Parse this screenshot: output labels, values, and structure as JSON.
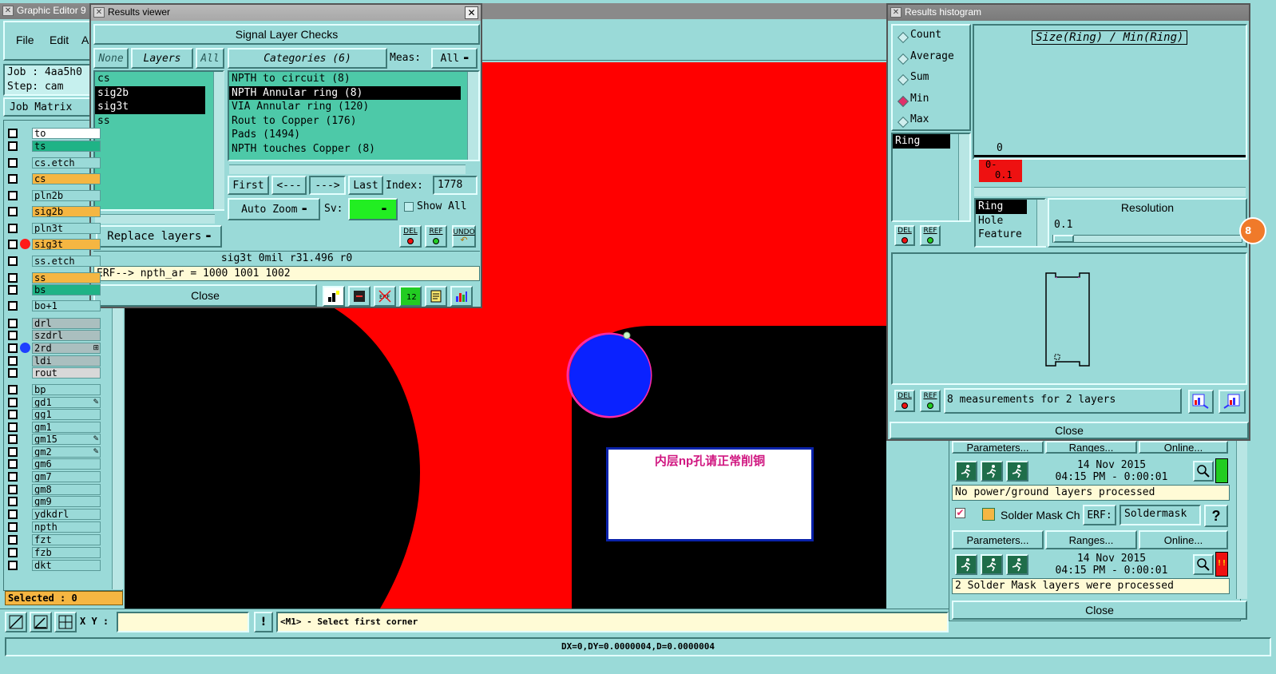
{
  "main_window": {
    "title": "Graphic Editor 9",
    "menu": [
      "File",
      "Edit",
      "A"
    ],
    "job_label": "Job : 4aa5h0",
    "step_label": "Step: cam",
    "job_matrix_label": "Job Matrix",
    "selected_label": "Selected : 0",
    "xy_label": "X Y :",
    "xy_value": "",
    "prompt": "<M1> - Select first corner",
    "status_bar": "DX=0,DY=0.0000004,D=0.0000004",
    "annotation_text": "内层np孔请正常削铜"
  },
  "layers": [
    {
      "name": "to",
      "fill": "#ffffff"
    },
    {
      "name": "ts",
      "fill": "#1fb386"
    },
    {
      "name": "cs.etch",
      "fill": "#9adad8"
    },
    {
      "name": "cs",
      "fill": "#f5b642"
    },
    {
      "name": "pln2b",
      "fill": "#9adad8"
    },
    {
      "name": "sig2b",
      "fill": "#f5b642"
    },
    {
      "name": "pln3t",
      "fill": "#9adad8"
    },
    {
      "name": "sig3t",
      "fill": "#f5b642",
      "dot": "#ff1a1a"
    },
    {
      "name": "ss.etch",
      "fill": "#9adad8"
    },
    {
      "name": "ss",
      "fill": "#f5b642"
    },
    {
      "name": "bs",
      "fill": "#1fb386"
    },
    {
      "name": "bo+1",
      "fill": "#9adad8"
    },
    {
      "name": "drl",
      "fill": "#aabfbf"
    },
    {
      "name": "szdrl",
      "fill": "#aabfbf"
    },
    {
      "name": "2rd",
      "fill": "#aabfbf",
      "dot": "#1f3fff",
      "mark": "⊞"
    },
    {
      "name": "ldi",
      "fill": "#aabfbf"
    },
    {
      "name": "rout",
      "fill": "#d8d8d8"
    },
    {
      "name": "bp",
      "fill": "#9adad8"
    },
    {
      "name": "gd1",
      "fill": "#9adad8",
      "mark": "✎"
    },
    {
      "name": "gg1",
      "fill": "#9adad8"
    },
    {
      "name": "gm1",
      "fill": "#9adad8"
    },
    {
      "name": "gm15",
      "fill": "#9adad8",
      "mark": "✎"
    },
    {
      "name": "gm2",
      "fill": "#9adad8",
      "mark": "✎"
    },
    {
      "name": "gm6",
      "fill": "#9adad8"
    },
    {
      "name": "gm7",
      "fill": "#9adad8"
    },
    {
      "name": "gm8",
      "fill": "#9adad8"
    },
    {
      "name": "gm9",
      "fill": "#9adad8"
    },
    {
      "name": "ydkdrl",
      "fill": "#9adad8"
    },
    {
      "name": "npth",
      "fill": "#9adad8"
    },
    {
      "name": "fzt",
      "fill": "#9adad8"
    },
    {
      "name": "fzb",
      "fill": "#9adad8"
    },
    {
      "name": "dkt",
      "fill": "#9adad8"
    }
  ],
  "results_viewer": {
    "title": "Results viewer",
    "header": "Signal Layer Checks",
    "none_btn": "None",
    "layers_btn": "Layers",
    "all_btn": "All",
    "layer_list": [
      {
        "name": "cs",
        "selected": false
      },
      {
        "name": "sig2b",
        "selected": true
      },
      {
        "name": "sig3t",
        "selected": true
      },
      {
        "name": "ss",
        "selected": false
      }
    ],
    "categories_btn": "Categories (6)",
    "meas_label": "Meas:",
    "meas_value": "All",
    "categories": [
      {
        "name": "NPTH to circuit (8)",
        "selected": false
      },
      {
        "name": "NPTH Annular ring (8)",
        "selected": true
      },
      {
        "name": "VIA Annular ring (120)",
        "selected": false
      },
      {
        "name": "Rout to Copper (176)",
        "selected": false
      },
      {
        "name": "Pads (1494)",
        "selected": false
      },
      {
        "name": "NPTH touches Copper (8)",
        "selected": false
      }
    ],
    "first_btn": "First",
    "prev_btn": "<---",
    "next_btn": "--->",
    "last_btn": "Last",
    "index_label": "Index:",
    "index_value": "1778",
    "auto_zoom": "Auto Zoom",
    "sv_label": "Sv:",
    "show_all": "Show All",
    "replace_layers": "Replace layers",
    "del_label": "DEL",
    "ref_label": "REF",
    "undo_label": "UNDO",
    "status_line": "sig3t  0mil   r31.496   r0",
    "erf_line": "ERF--> npth_ar = 1000 1001 1002",
    "close": "Close"
  },
  "histogram": {
    "title": "Results histogram",
    "modes": [
      {
        "label": "Count",
        "on": false
      },
      {
        "label": "Average",
        "on": false
      },
      {
        "label": "Sum",
        "on": false
      },
      {
        "label": "Min",
        "on": true
      },
      {
        "label": "Max",
        "on": false
      }
    ],
    "chart_title": "Size(Ring) / Min(Ring)",
    "chart_value": "0",
    "bin_label_1": "0-",
    "bin_label_2": "0.1",
    "left_list": [
      "Ring"
    ],
    "measure_list": [
      {
        "name": "Ring",
        "selected": true
      },
      {
        "name": "Hole",
        "selected": false
      },
      {
        "name": "Feature",
        "selected": false
      }
    ],
    "resolution_label": "Resolution",
    "resolution_value": "0.1",
    "measurements_text": "8 measurements for 2 layers",
    "close": "Close",
    "badge": "8"
  },
  "checklist": {
    "params_btn": "Parameters...",
    "ranges_btn": "Ranges...",
    "online_btn": "Online...",
    "date1": "14 Nov 2015",
    "time1": "04:15 PM - 0:00:01",
    "msg1": "No power/ground layers processed",
    "item2_label": "Solder Mask Ch",
    "erf_label": "ERF:",
    "erf_value": "Soldermask",
    "help": "?",
    "date2": "14 Nov 2015",
    "time2": "04:15 PM - 0:00:01",
    "msg2": "2 Solder Mask layers were processed",
    "alert": "!!",
    "close": "Close"
  }
}
